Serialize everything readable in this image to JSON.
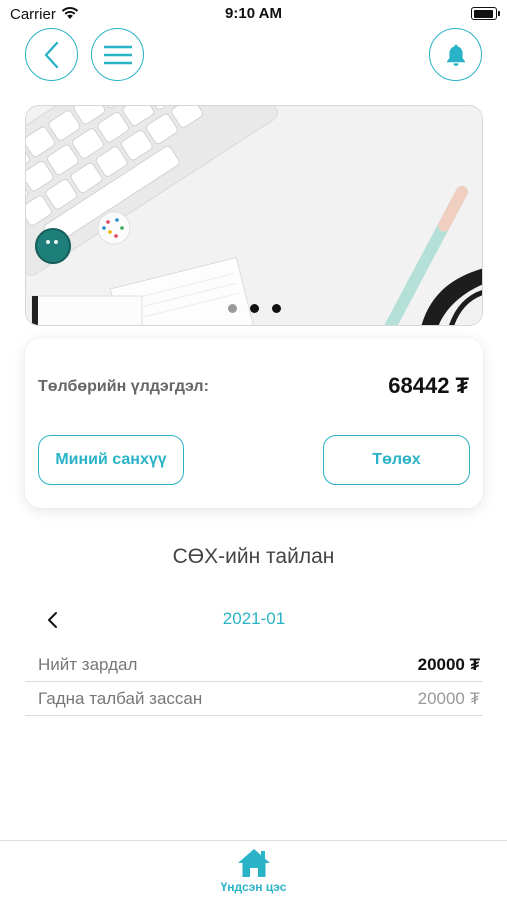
{
  "status_bar": {
    "carrier": "Carrier",
    "time": "9:10 AM"
  },
  "header": {
    "back_icon": "chevron-left-icon",
    "menu_icon": "hamburger-menu-icon",
    "bell_icon": "bell-icon",
    "accent_color": "#2ab3c7"
  },
  "banner": {
    "page_count": 3,
    "active_page": 2
  },
  "balance_card": {
    "label": "Төлбөрийн үлдэгдэл:",
    "value": "68442 ₮",
    "finance_button": "Миний санхүү",
    "pay_button": "Төлөх"
  },
  "report": {
    "title": "СӨХ-ийн тайлан",
    "month": "2021-01",
    "rows": [
      {
        "label": "Нийт зардал",
        "value": "20000 ₮"
      },
      {
        "label": "Гадна талбай зассан",
        "value": "20000 ₮"
      }
    ]
  },
  "tab_bar": {
    "home_label": "Үндсэн цэс",
    "home_icon": "home-icon"
  }
}
